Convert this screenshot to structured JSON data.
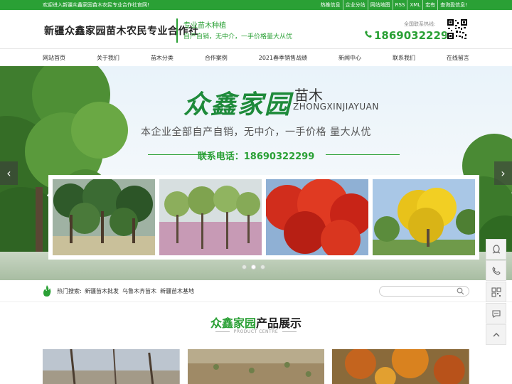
{
  "topbar": {
    "welcome": "欢迎进入新疆众鑫家园苗木农民专业合作社官网!",
    "links": [
      "热推信息",
      "企业分站",
      "网站地图",
      "RSS",
      "XML",
      "宏有",
      "查询盈信息!"
    ]
  },
  "header": {
    "site_title": "新疆众鑫家园苗木农民专业合作社",
    "slogan_main": "专业苗木种植",
    "slogan_sub": "自产自销，无中介，一手价格量大从优",
    "hotline_label": "全国联系热线:",
    "hotline": "18690322299"
  },
  "nav": {
    "items": [
      "网站首页",
      "关于我们",
      "苗木分类",
      "合作案例",
      "2021春季销售战绩",
      "新闻中心",
      "联系我们",
      "在线留言"
    ]
  },
  "banner": {
    "brand": "众鑫家园",
    "brand_suffix": "苗木",
    "pinyin": "ZHONGXINJIAYUAN",
    "tagline": "本企业全部自产自销，无中介，一手价格 量大从优",
    "phone_text": "联系电话：18690322299",
    "slide_count": 3,
    "active_slide": 2
  },
  "search": {
    "hot_label": "热门搜索:",
    "hot_links": [
      "新疆苗木批发",
      "乌鲁木齐苗木",
      "新疆苗木基地"
    ],
    "placeholder": ""
  },
  "products": {
    "title_green": "众鑫家园",
    "title_rest": "产品展示",
    "subtitle": "PRODUCT CENTRE"
  },
  "colors": {
    "brand_green": "#2aa035",
    "topbar_green": "#2aa035"
  },
  "icons": {
    "arrow_left": "chevron-left-icon",
    "arrow_right": "chevron-right-icon",
    "sidebar": [
      "qq-icon",
      "phone-icon",
      "qrcode-icon",
      "chat-icon",
      "back-to-top-icon"
    ]
  }
}
